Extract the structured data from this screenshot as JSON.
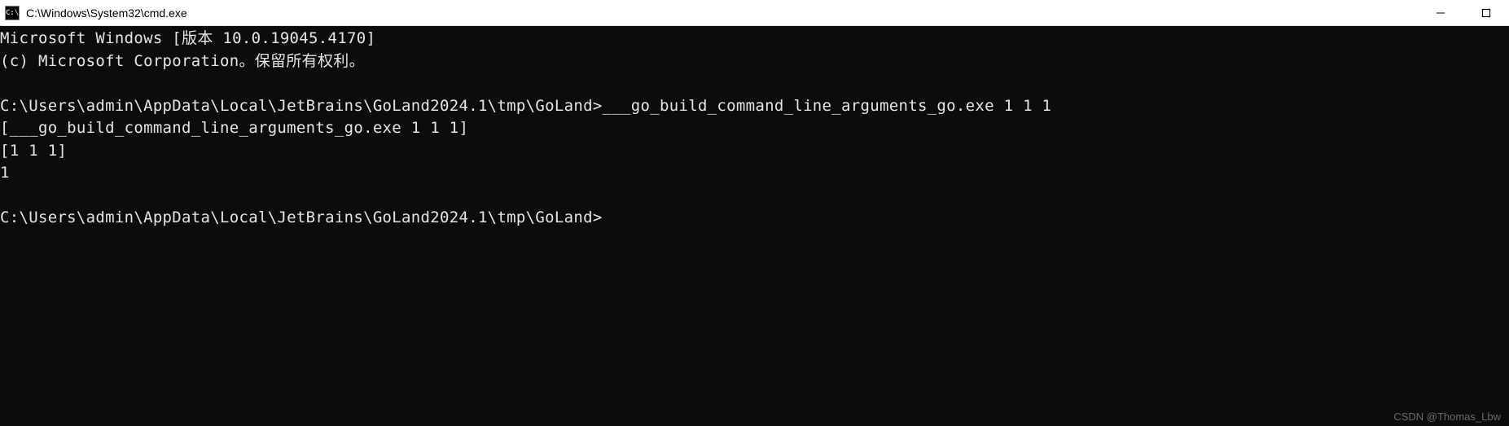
{
  "titlebar": {
    "icon_text": "C:\\",
    "title": "C:\\Windows\\System32\\cmd.exe"
  },
  "terminal": {
    "line1": "Microsoft Windows [版本 10.0.19045.4170]",
    "line2": "(c) Microsoft Corporation。保留所有权利。",
    "line3": "",
    "line4": "C:\\Users\\admin\\AppData\\Local\\JetBrains\\GoLand2024.1\\tmp\\GoLand>___go_build_command_line_arguments_go.exe 1 1 1",
    "line5": "[___go_build_command_line_arguments_go.exe 1 1 1]",
    "line6": "[1 1 1]",
    "line7": "1",
    "line8": "",
    "line9": "C:\\Users\\admin\\AppData\\Local\\JetBrains\\GoLand2024.1\\tmp\\GoLand>"
  },
  "watermark": "CSDN @Thomas_Lbw"
}
